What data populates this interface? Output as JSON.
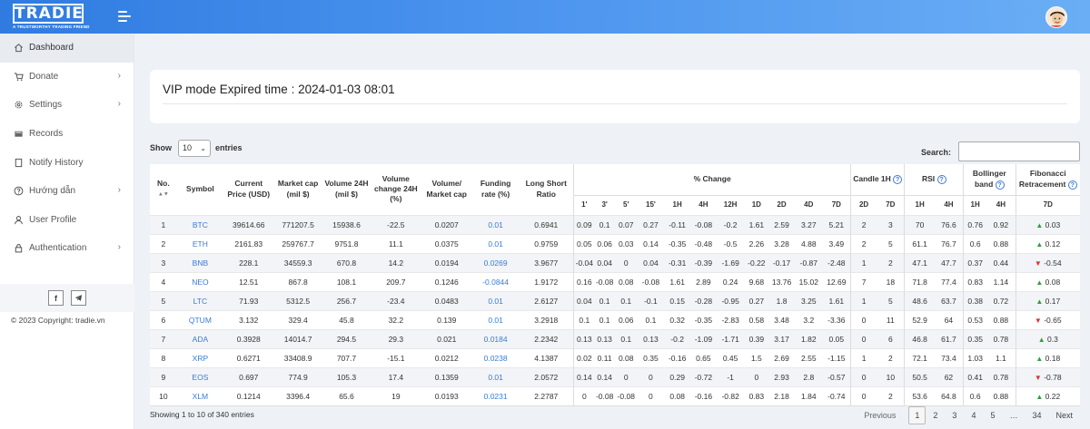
{
  "app": {
    "logo_text": "TRADIE",
    "logo_tagline": "A TRUSTWORTHY TRADING FRIEND"
  },
  "sidebar": {
    "items": [
      {
        "label": "Dashboard",
        "icon": "home-icon"
      },
      {
        "label": "Donate",
        "icon": "cart-icon"
      },
      {
        "label": "Settings",
        "icon": "gear-icon"
      },
      {
        "label": "Records",
        "icon": "records-icon"
      },
      {
        "label": "Notify History",
        "icon": "book-icon"
      },
      {
        "label": "Hướng dẫn",
        "icon": "help-icon"
      },
      {
        "label": "User Profile",
        "icon": "user-icon"
      },
      {
        "label": "Authentication",
        "icon": "lock-icon"
      }
    ],
    "social": {
      "facebook": "f",
      "telegram": "telegram-icon"
    },
    "copyright": "© 2023 Copyright: tradie.vn"
  },
  "vip": {
    "title": "VIP mode Expired time :  2024-01-03 08:01"
  },
  "controls": {
    "show_label": "Show",
    "entries_value": "10",
    "entries_label": "entries",
    "search_label": "Search:",
    "search_value": ""
  },
  "table": {
    "headers": {
      "no": "No.",
      "symbol": "Symbol",
      "current_price": "Current Price (USD)",
      "market_cap": "Market cap (mil $)",
      "volume_24h": "Volume 24H (mil $)",
      "volume_change": "Volume change 24H (%)",
      "volume_market_cap": "Volume/ Market cap",
      "funding_rate": "Funding rate (%)",
      "long_short": "Long Short Ratio",
      "pct_change": "% Change",
      "candle_1h": "Candle 1H",
      "rsi": "RSI",
      "bollinger": "Bollinger band",
      "fibonacci": "Fibonacci Retracement"
    },
    "sub_headers": {
      "pct_change": [
        "1'",
        "3'",
        "5'",
        "15'",
        "1H",
        "4H",
        "12H",
        "1D",
        "2D",
        "4D",
        "7D"
      ],
      "candle": [
        "2D",
        "7D"
      ],
      "rsi": [
        "1H",
        "4H"
      ],
      "bollinger": [
        "1H",
        "4H"
      ],
      "fibonacci": [
        "7D"
      ]
    },
    "rows": [
      {
        "no": "1",
        "symbol": "BTC",
        "price": "39614.66",
        "mcap": "771207.5",
        "vol": "15938.6",
        "volchg": "-22.5",
        "volmcap": "0.0207",
        "funding": "0.01",
        "ls": "0.6941",
        "chg": [
          "0.09",
          "0.1",
          "0.07",
          "0.27",
          "-0.11",
          "-0.08",
          "-0.2",
          "1.61",
          "2.59",
          "3.27",
          "5.21"
        ],
        "candle": [
          "2",
          "3"
        ],
        "rsi": [
          "70",
          "76.6"
        ],
        "bb": [
          "0.76",
          "0.92"
        ],
        "fib_dir": "up",
        "fib": "0.03"
      },
      {
        "no": "2",
        "symbol": "ETH",
        "price": "2161.83",
        "mcap": "259767.7",
        "vol": "9751.8",
        "volchg": "11.1",
        "volmcap": "0.0375",
        "funding": "0.01",
        "ls": "0.9759",
        "chg": [
          "0.05",
          "0.06",
          "0.03",
          "0.14",
          "-0.35",
          "-0.48",
          "-0.5",
          "2.26",
          "3.28",
          "4.88",
          "3.49"
        ],
        "candle": [
          "2",
          "5"
        ],
        "rsi": [
          "61.1",
          "76.7"
        ],
        "bb": [
          "0.6",
          "0.88"
        ],
        "fib_dir": "up",
        "fib": "0.12"
      },
      {
        "no": "3",
        "symbol": "BNB",
        "price": "228.1",
        "mcap": "34559.3",
        "vol": "670.8",
        "volchg": "14.2",
        "volmcap": "0.0194",
        "funding": "0.0269",
        "ls": "3.9677",
        "chg": [
          "-0.04",
          "0.04",
          "0",
          "0.04",
          "-0.31",
          "-0.39",
          "-1.69",
          "-0.22",
          "-0.17",
          "-0.87",
          "-2.48"
        ],
        "candle": [
          "1",
          "2"
        ],
        "rsi": [
          "47.1",
          "47.7"
        ],
        "bb": [
          "0.37",
          "0.44"
        ],
        "fib_dir": "down",
        "fib": "-0.54"
      },
      {
        "no": "4",
        "symbol": "NEO",
        "price": "12.51",
        "mcap": "867.8",
        "vol": "108.1",
        "volchg": "209.7",
        "volmcap": "0.1246",
        "funding": "-0.0844",
        "ls": "1.9172",
        "chg": [
          "0.16",
          "-0.08",
          "0.08",
          "-0.08",
          "1.61",
          "2.89",
          "0.24",
          "9.68",
          "13.76",
          "15.02",
          "12.69"
        ],
        "candle": [
          "7",
          "18"
        ],
        "rsi": [
          "71.8",
          "77.4"
        ],
        "bb": [
          "0.83",
          "1.14"
        ],
        "fib_dir": "up",
        "fib": "0.08"
      },
      {
        "no": "5",
        "symbol": "LTC",
        "price": "71.93",
        "mcap": "5312.5",
        "vol": "256.7",
        "volchg": "-23.4",
        "volmcap": "0.0483",
        "funding": "0.01",
        "ls": "2.6127",
        "chg": [
          "0.04",
          "0.1",
          "0.1",
          "-0.1",
          "0.15",
          "-0.28",
          "-0.95",
          "0.27",
          "1.8",
          "3.25",
          "1.61"
        ],
        "candle": [
          "1",
          "5"
        ],
        "rsi": [
          "48.6",
          "63.7"
        ],
        "bb": [
          "0.38",
          "0.72"
        ],
        "fib_dir": "up",
        "fib": "0.17"
      },
      {
        "no": "6",
        "symbol": "QTUM",
        "price": "3.132",
        "mcap": "329.4",
        "vol": "45.8",
        "volchg": "32.2",
        "volmcap": "0.139",
        "funding": "0.01",
        "ls": "3.2918",
        "chg": [
          "0.1",
          "0.1",
          "0.06",
          "0.1",
          "0.32",
          "-0.35",
          "-2.83",
          "0.58",
          "3.48",
          "3.2",
          "-3.36"
        ],
        "candle": [
          "0",
          "11"
        ],
        "rsi": [
          "52.9",
          "64"
        ],
        "bb": [
          "0.53",
          "0.88"
        ],
        "fib_dir": "down",
        "fib": "-0.65"
      },
      {
        "no": "7",
        "symbol": "ADA",
        "price": "0.3928",
        "mcap": "14014.7",
        "vol": "294.5",
        "volchg": "29.3",
        "volmcap": "0.021",
        "funding": "0.0184",
        "ls": "2.2342",
        "chg": [
          "0.13",
          "0.13",
          "0.1",
          "0.13",
          "-0.2",
          "-1.09",
          "-1.71",
          "0.39",
          "3.17",
          "1.82",
          "0.05"
        ],
        "candle": [
          "0",
          "6"
        ],
        "rsi": [
          "46.8",
          "61.7"
        ],
        "bb": [
          "0.35",
          "0.78"
        ],
        "fib_dir": "up",
        "fib": "0.3"
      },
      {
        "no": "8",
        "symbol": "XRP",
        "price": "0.6271",
        "mcap": "33408.9",
        "vol": "707.7",
        "volchg": "-15.1",
        "volmcap": "0.0212",
        "funding": "0.0238",
        "ls": "4.1387",
        "chg": [
          "0.02",
          "0.11",
          "0.08",
          "0.35",
          "-0.16",
          "0.65",
          "0.45",
          "1.5",
          "2.69",
          "2.55",
          "-1.15"
        ],
        "candle": [
          "1",
          "2"
        ],
        "rsi": [
          "72.1",
          "73.4"
        ],
        "bb": [
          "1.03",
          "1.1"
        ],
        "fib_dir": "up",
        "fib": "0.18"
      },
      {
        "no": "9",
        "symbol": "EOS",
        "price": "0.697",
        "mcap": "774.9",
        "vol": "105.3",
        "volchg": "17.4",
        "volmcap": "0.1359",
        "funding": "0.01",
        "ls": "2.0572",
        "chg": [
          "0.14",
          "0.14",
          "0",
          "0",
          "0.29",
          "-0.72",
          "-1",
          "0",
          "2.93",
          "2.8",
          "-0.57"
        ],
        "candle": [
          "0",
          "10"
        ],
        "rsi": [
          "50.5",
          "62"
        ],
        "bb": [
          "0.41",
          "0.78"
        ],
        "fib_dir": "down",
        "fib": "-0.78"
      },
      {
        "no": "10",
        "symbol": "XLM",
        "price": "0.1214",
        "mcap": "3396.4",
        "vol": "65.6",
        "volchg": "19",
        "volmcap": "0.0193",
        "funding": "0.0231",
        "ls": "2.2787",
        "chg": [
          "0",
          "-0.08",
          "-0.08",
          "0",
          "0.08",
          "-0.16",
          "-0.82",
          "0.83",
          "2.18",
          "1.84",
          "-0.74"
        ],
        "candle": [
          "0",
          "2"
        ],
        "rsi": [
          "53.6",
          "64.8"
        ],
        "bb": [
          "0.6",
          "0.88"
        ],
        "fib_dir": "up",
        "fib": "0.22"
      }
    ]
  },
  "footer": {
    "info": "Showing 1 to 10 of 340 entries",
    "pagination": {
      "previous": "Previous",
      "pages": [
        "1",
        "2",
        "3",
        "4",
        "5",
        "…",
        "34"
      ],
      "active": "1",
      "next": "Next"
    }
  },
  "colors": {
    "topbar_start": "#2f7be0",
    "topbar_end": "#6aaef5",
    "link_blue": "#3a7bd5",
    "up_green": "#2e9e3e",
    "down_red": "#dd3333"
  }
}
